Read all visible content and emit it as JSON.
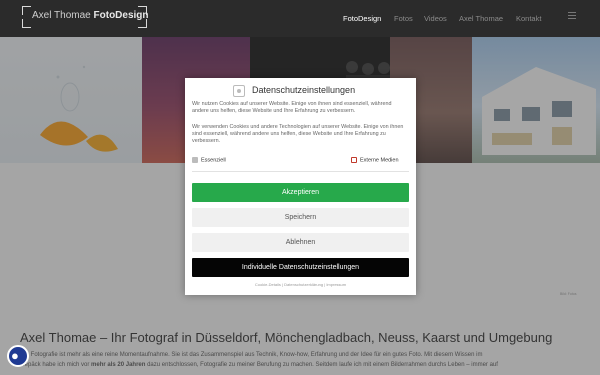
{
  "header": {
    "logo_name": "Axel Thomae",
    "logo_bold": "FotoDesign",
    "nav": [
      "FotoDesign",
      "Fotos",
      "Videos",
      "Axel Thomae",
      "Kontakt"
    ],
    "active_nav": "FotoDesign"
  },
  "consent": {
    "title": "Datenschutzeinstellungen",
    "text1": "Wir nutzen Cookies auf unserer Website. Einige von ihnen sind essenziell, während andere uns helfen, diese Website und Ihre Erfahrung zu verbessern.",
    "text2": "Wir verwenden Cookies und andere Technologien auf unserer Website. Einige von ihnen sind essenziell, während andere uns helfen, diese Website und Ihre Erfahrung zu verbessern.",
    "option_essential": "Essenziell",
    "option_external": "Externe Medien",
    "accept_label": "Akzeptieren",
    "save_label": "Speichern",
    "reject_label": "Ablehnen",
    "custom_label": "Individuelle Datenschutzeinstellungen",
    "links": "Cookie-Details | Datenschutzerklärung | Impressum"
  },
  "content": {
    "credit": "Bild: Fotos",
    "headline": "Axel Thomae – Ihr Fotograf in Düsseldorf, Mönchengladbach, Neuss, Kaarst und Umgebung",
    "para_line1": "Die Fotografie ist mehr als eine reine Momentaufnahme. Sie ist das Zusammenspiel aus Technik, Know-how, Erfahrung und der Idee für ein gutes Foto. Mit diesem Wissen im",
    "para_line2_a": "Gepäck habe ich mich vor ",
    "para_line2_b": "mehr als 20 Jahren",
    "para_line2_c": " dazu entschlossen, Fotografie zu meiner Berufung zu machen. Seitdem laufe ich mit einem Bilderrahmen durchs Leben – immer auf"
  },
  "colors": {
    "accept": "#27a94b",
    "custom": "#050505",
    "header": "#2b2b2b",
    "cookie_float": "#1f3a93"
  }
}
